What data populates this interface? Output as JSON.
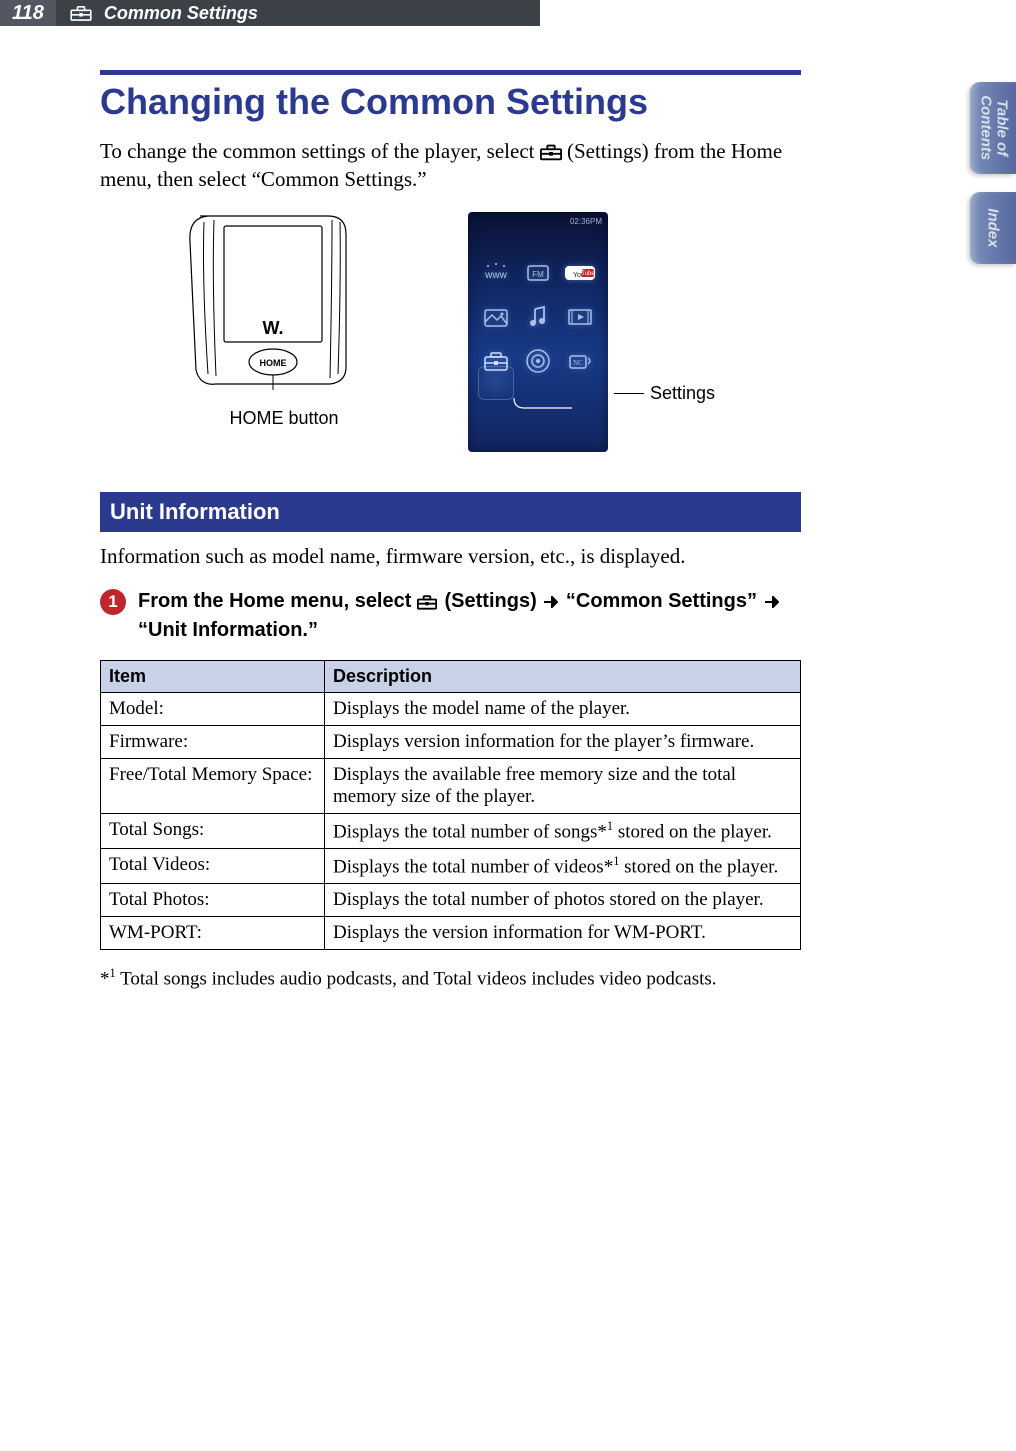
{
  "header": {
    "page_number": "118",
    "breadcrumb": "Common Settings"
  },
  "side_tabs": {
    "toc": "Table of\nContents",
    "index": "Index"
  },
  "title": "Changing the Common Settings",
  "intro": {
    "pre": "To change the common settings of the player, select ",
    "mid": " (Settings) from the Home menu, then select “Common Settings.”"
  },
  "figures": {
    "home_button_label": "HOME button",
    "home_text": "HOME",
    "menu_status": "02:36PM",
    "callout": "Settings"
  },
  "section": {
    "title": "Unit Information",
    "intro": "Information such as model name, firmware version, etc., is displayed."
  },
  "step": {
    "num": "1",
    "a": "From the Home menu, select ",
    "b": " (Settings) ",
    "c": " “Common Settings” ",
    "d": " “Unit Information.”"
  },
  "table": {
    "th_item": "Item",
    "th_desc": "Description",
    "rows": [
      {
        "item": "Model:",
        "desc": "Displays the model name of the player."
      },
      {
        "item": "Firmware:",
        "desc": "Displays version information for the player’s firmware."
      },
      {
        "item": "Free/Total Memory Space:",
        "desc": "Displays the available free memory size and the total memory size of the player."
      },
      {
        "item": "Total Songs:",
        "desc_pre": "Displays the total number of songs*",
        "desc_sup": "1",
        "desc_post": " stored on the player."
      },
      {
        "item": "Total Videos:",
        "desc_pre": "Displays the total number of videos*",
        "desc_sup": "1",
        "desc_post": " stored on the player."
      },
      {
        "item": "Total Photos:",
        "desc": "Displays the total number of photos stored on the player."
      },
      {
        "item": "WM-PORT:",
        "desc": "Displays the version information for WM-PORT."
      }
    ]
  },
  "footnote": {
    "marker": "*",
    "sup": "1",
    "text": " Total songs includes audio podcasts, and Total videos includes video podcasts."
  }
}
